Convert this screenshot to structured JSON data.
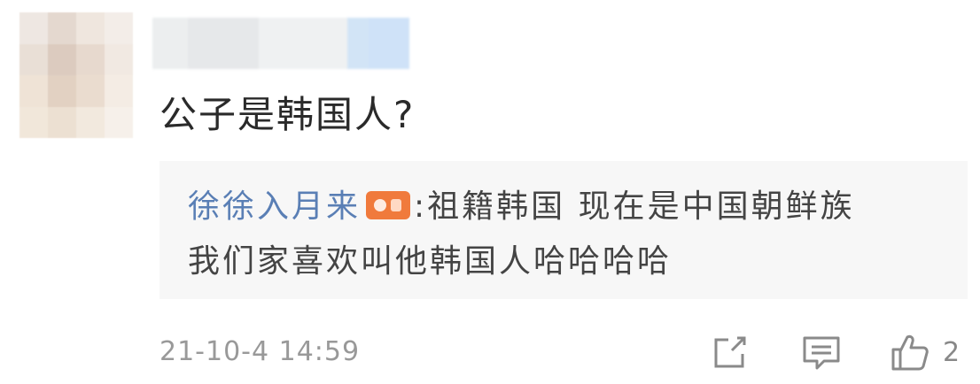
{
  "comment": {
    "text": "公子是韩国人?"
  },
  "reply": {
    "author": "徐徐入月来",
    "separator": ":",
    "line1_rest": "祖籍韩国 现在是中国朝鲜族",
    "line2": "我们家喜欢叫他韩国人哈哈哈哈"
  },
  "footer": {
    "timestamp": "21-10-4 14:59",
    "like_count": "2"
  },
  "icons": {
    "share": "share-icon",
    "comment": "comment-icon",
    "like": "thumbs-up-icon"
  },
  "colors": {
    "author": "#5a7fb5",
    "vip_badge": "#f07a3c",
    "reply_bg": "#f7f7f7"
  }
}
